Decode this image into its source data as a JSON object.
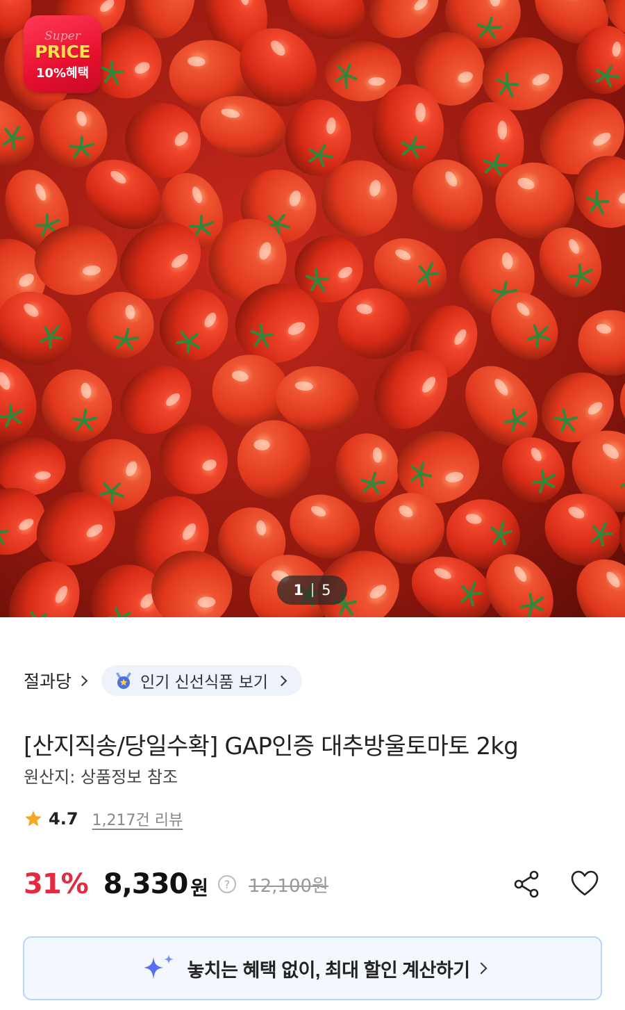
{
  "hero": {
    "badge": {
      "super": "Super",
      "price": "PRICE",
      "benefit": "10%혜택"
    },
    "pager": {
      "current": "1",
      "total": "5"
    }
  },
  "breadcrumb": {
    "seller": "절과당",
    "popular_link": "인기 신선식품 보기"
  },
  "product": {
    "title": "[산지직송/당일수확] GAP인증 대추방울토마토 2kg",
    "origin": "원산지: 상품정보 참조",
    "rating": "4.7",
    "reviews": "1,217건 리뷰"
  },
  "price": {
    "discount": "31%",
    "sale": "8,330",
    "unit": "원",
    "help_icon": "?",
    "original": "12,100원"
  },
  "colors": {
    "discount": "#e32a3f",
    "accent_blue": "#5a6cf0",
    "star": "#f5a623"
  },
  "benefit_banner": {
    "text": "놓치는 혜택 없이, 최대 할인 계산하기"
  }
}
